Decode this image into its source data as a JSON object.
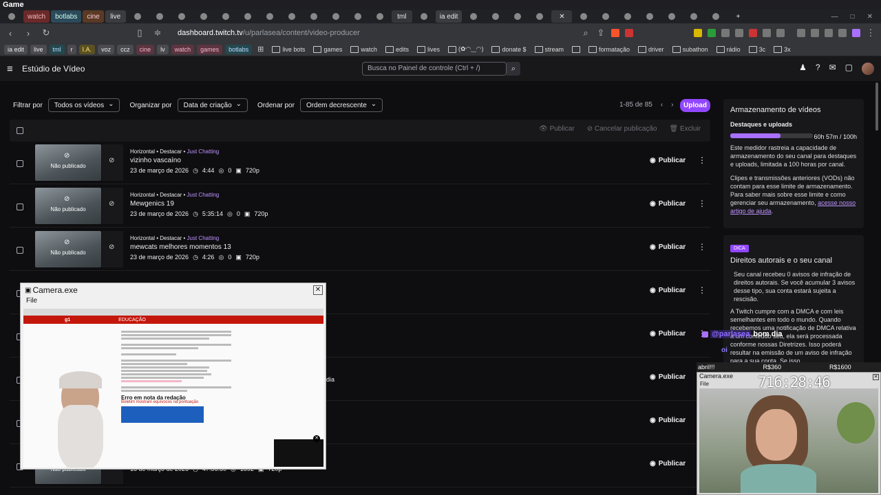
{
  "os": {
    "title": "Game"
  },
  "tabs": [
    {
      "label": "",
      "kind": "icon"
    },
    {
      "label": "watch",
      "kind": "c1"
    },
    {
      "label": "botlabs",
      "kind": "c2"
    },
    {
      "label": "cine",
      "kind": "c3"
    },
    {
      "label": "live",
      "kind": "label"
    },
    {
      "label": "",
      "kind": "icon"
    },
    {
      "label": "",
      "kind": "icon"
    },
    {
      "label": "",
      "kind": "icon"
    },
    {
      "label": "",
      "kind": "icon"
    },
    {
      "label": "",
      "kind": "icon"
    },
    {
      "label": "",
      "kind": "icon"
    },
    {
      "label": "",
      "kind": "icon"
    },
    {
      "label": "",
      "kind": "icon"
    },
    {
      "label": "",
      "kind": "icon"
    },
    {
      "label": "",
      "kind": "icon"
    },
    {
      "label": "",
      "kind": "icon"
    },
    {
      "label": "",
      "kind": "icon"
    },
    {
      "label": "tml",
      "kind": "active"
    },
    {
      "label": "",
      "kind": "icon"
    },
    {
      "label": "ia edit",
      "kind": "label"
    },
    {
      "label": "",
      "kind": "icon"
    },
    {
      "label": "",
      "kind": "icon"
    },
    {
      "label": "",
      "kind": "icon"
    },
    {
      "label": "",
      "kind": "icon"
    },
    {
      "label": "✕",
      "kind": "active"
    },
    {
      "label": "",
      "kind": "icon"
    },
    {
      "label": "",
      "kind": "icon"
    },
    {
      "label": "",
      "kind": "icon"
    },
    {
      "label": "",
      "kind": "icon"
    },
    {
      "label": "",
      "kind": "icon"
    },
    {
      "label": "",
      "kind": "icon"
    },
    {
      "label": "",
      "kind": "icon"
    },
    {
      "label": "+",
      "kind": "icon"
    }
  ],
  "address": {
    "url_domain": "dashboard.twitch.tv",
    "url_path": "/u/parlasea/content/video-producer"
  },
  "bookmarks": {
    "chips": [
      {
        "label": "ia edit",
        "style": "chip"
      },
      {
        "label": "live",
        "style": "chip"
      },
      {
        "label": "tml",
        "style": "chip teal"
      },
      {
        "label": "r",
        "style": "chip"
      },
      {
        "label": "I.A.",
        "style": "chip gold"
      },
      {
        "label": "voz",
        "style": "chip"
      },
      {
        "label": "ccz",
        "style": "chip"
      },
      {
        "label": "cine",
        "style": "chip pink"
      },
      {
        "label": "lv",
        "style": "chip"
      },
      {
        "label": "watch",
        "style": "chip pink"
      },
      {
        "label": "games",
        "style": "chip pink"
      },
      {
        "label": "botlabs",
        "style": "chip teal"
      }
    ],
    "folders": [
      "live bots",
      "games",
      "watch",
      "edits",
      "lives",
      "(✿◠‿◠)",
      "donate $",
      "stream",
      "",
      "formatação",
      "driver",
      "subathon",
      "rádio",
      "3c",
      "3x"
    ]
  },
  "header": {
    "title": "Estúdio de Vídeo",
    "search_placeholder": "Busca no Painel de controle (Ctrl + /)"
  },
  "filters": {
    "filter_label": "Filtrar por",
    "filter_value": "Todos os vídeos",
    "organize_label": "Organizar por",
    "organize_value": "Data de criação",
    "order_label": "Ordenar por",
    "order_value": "Ordem decrescente",
    "pagination": "1-85 de 85",
    "upload": "Upload"
  },
  "table": {
    "actions": {
      "publish": "Publicar",
      "unpublish": "Cancelar publicação",
      "delete": "Excluir"
    },
    "rows": [
      {
        "meta": "Horizontal • Destacar • ",
        "category": "Just Chatting",
        "title": "vizinho vascaíno",
        "date": "23 de março de 2026",
        "duration": "4:44",
        "views": "0",
        "quality": "720p",
        "status": "Não publicado",
        "publish": "Publicar"
      },
      {
        "meta": "Horizontal • Destacar • ",
        "category": "Just Chatting",
        "title": "Mewgenics 19",
        "date": "23 de março de 2026",
        "duration": "5:35:14",
        "views": "0",
        "quality": "720p",
        "status": "Não publicado",
        "publish": "Publicar"
      },
      {
        "meta": "Horizontal • Destacar • ",
        "category": "Just Chatting",
        "title": "mewcats melhores momentos 13",
        "date": "23 de março de 2026",
        "duration": "4:26",
        "views": "0",
        "quality": "720p",
        "status": "Não publicado",
        "publish": "Publicar"
      },
      {
        "meta": "",
        "category": "",
        "title": "",
        "date": "",
        "duration": "",
        "views": "",
        "quality": "",
        "status": "",
        "publish": "Publicar"
      },
      {
        "meta": "",
        "category": "",
        "title": "",
        "date": "",
        "duration": "",
        "views": "",
        "quality": "",
        "status": "",
        "publish": "Publicar"
      },
      {
        "meta": "",
        "category": "",
        "title": "",
        "date": "",
        "duration": "",
        "views": "",
        "quality": "",
        "status": "",
        "publish": "Publicar"
      },
      {
        "meta": "",
        "category": "",
        "title": "",
        "date": "",
        "duration": "",
        "views": "",
        "quality": "",
        "status": "",
        "publish": "Publicar"
      },
      {
        "meta": "",
        "category": "",
        "title": "",
        "date": "18 de março de 2026",
        "duration": "47:56:30",
        "views": "1892",
        "quality": "720p",
        "status": "Não publicado",
        "publish": "Publicar"
      }
    ]
  },
  "storage": {
    "title": "Armazenamento de vídeos",
    "sub": "Destaques e uploads",
    "used": "60h 57m / 100h",
    "fill_fraction": 0.61,
    "p1": "Este medidor rastreia a capacidade de armazenamento do seu canal para destaques e uploads, limitada a 100 horas por canal.",
    "p2": "Clipes e transmissões anteriores (VODs) não contam para esse limite de armazenamento. Para saber mais sobre esse limite e como gerenciar seu armazenamento, ",
    "link": "acesse nosso artigo de ajuda",
    "p2_end": "."
  },
  "tip": {
    "badge": "DICA",
    "title": "Direitos autorais e o seu canal",
    "p1": "Seu canal recebeu 0 avisos de infração de direitos autorais. Se você acumular 3 avisos desse tipo, sua conta estará sujeita a rescisão.",
    "p2": "A Twitch cumpre com a DMCA e com leis semelhantes em todo o mundo. Quando recebemos uma notificação de DMCA relativa a um conteúdo seu, ela será processada conforme nossas Diretrizes. Isso poderá resultar na emissão de um aviso de infração para a sua conta. Se isso"
  },
  "chat": {
    "user": "@parlasea",
    "msg": "bom dia",
    "l2": "oi",
    "icon_label": "dia"
  },
  "camera1": {
    "title": "Camera.exe",
    "menu": "File",
    "site": "g1",
    "section": "EDUCAÇÃO",
    "headline": "Erro em nota da redação",
    "subhead": "Boletim mostram equívocos na pontuação"
  },
  "camera2": {
    "top_left": "abril!!!",
    "top_mid": "R$360",
    "top_right": "R$1600",
    "title": "Camera.exe",
    "menu": "File",
    "timer": "716:28:46"
  }
}
